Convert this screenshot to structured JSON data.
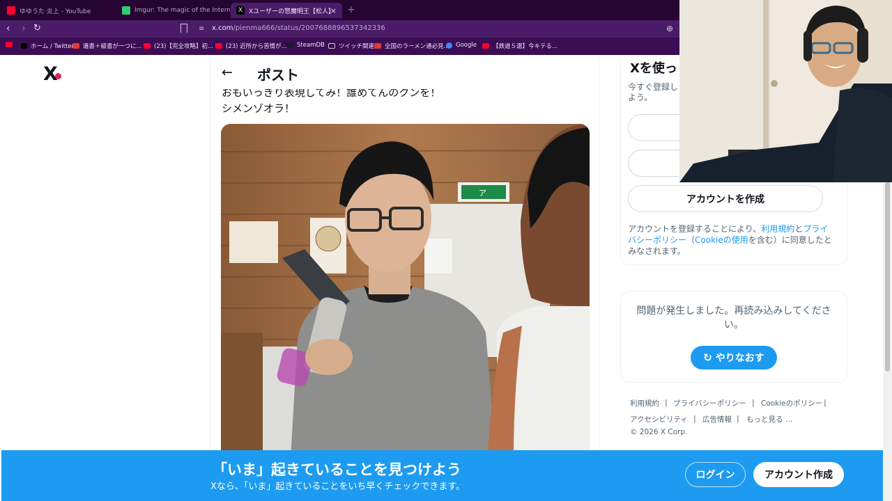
{
  "browser": {
    "tabs": [
      {
        "title": "ゆゆうた 炎上 - YouTube",
        "active": false,
        "favicon_color": "#ff0033"
      },
      {
        "title": "Imgur: The magic of the Internet",
        "active": false,
        "favicon_color": "#2ecc71"
      },
      {
        "title": "Xユーザーの惣魔明王【松人】さん:「な",
        "active": true,
        "favicon_color": "#000000"
      }
    ],
    "new_tab": "+",
    "tab_close": "×",
    "url_host": "x.com",
    "url_path": "/pienma666/status/2007688896537342336",
    "bookmarks": [
      {
        "label": "ホーム / Twitter",
        "icon_color": "#000000"
      },
      {
        "label": "遺書＋級書が一つに...",
        "icon_color": "#e53935"
      },
      {
        "label": "(23)【完全攻略】初...",
        "icon_color": "#ff0033"
      },
      {
        "label": "(23) 近所から苦情が...",
        "icon_color": "#ff0033"
      },
      {
        "label": "SteamDB",
        "icon_color": "#1b1b2f"
      },
      {
        "label": "ツイッチ関連",
        "icon_color": "#cccccc"
      },
      {
        "label": "全国のラーメン通必見...",
        "icon_color": "#e53935"
      },
      {
        "label": "Google",
        "icon_color": "#4285f4"
      },
      {
        "label": "【鉄道５選】今キテる...",
        "icon_color": "#ff0033"
      }
    ]
  },
  "x_page": {
    "logo": "X",
    "header": {
      "back": "←",
      "title": "ポスト"
    },
    "tweet": {
      "line1": "おもいっきり表現してみ！誰めてんのクンを！",
      "line2": "シメンゾオラ！"
    },
    "sidebar": {
      "signup_title": "Xを使っ",
      "signup_subtitle": "今すぐ登録し よう。",
      "apple_icon": "",
      "create_account": "アカウントを作成",
      "legal_prefix": "アカウントを登録することにより、",
      "legal_terms": "利用規約",
      "legal_and": "と",
      "legal_privacy": "プライバシーポリシー",
      "legal_paren_open": "（",
      "legal_cookie": "Cookieの使用",
      "legal_rest": "を含む）に同意したとみなされます。"
    },
    "error": {
      "message": "問題が発生しました。再読み込みしてください。",
      "retry_icon": "↻",
      "retry_label": "やりなおす"
    },
    "footer": {
      "links": [
        "利用規約",
        "プライバシーポリシー",
        "Cookieのポリシー",
        "アクセシビリティ",
        "広告情報",
        "もっと見る …"
      ],
      "separator": "|",
      "copyright": "© 2026 X Corp."
    },
    "banner": {
      "headline": "「いま」起きていることを見つけよう",
      "subline": "Xなら、「いま」起きていることをいち早くチェックできます。",
      "login": "ログイン",
      "signup": "アカウント作成"
    }
  },
  "photo_sign": "ア"
}
